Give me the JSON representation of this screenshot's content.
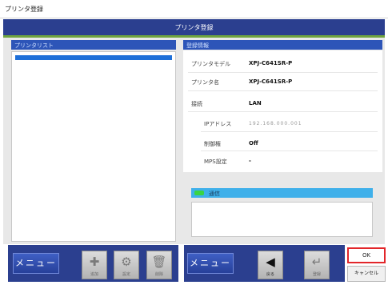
{
  "window": {
    "title": "プリンタ登録"
  },
  "header": {
    "title": "プリンタ登録"
  },
  "left_panel": {
    "title": "プリンタリスト"
  },
  "right_panel": {
    "title": "登録情報",
    "rows": {
      "model": {
        "label": "プリンタモデル",
        "value": "XPJ-C641SR-P"
      },
      "name": {
        "label": "プリンタ名",
        "value": "XPJ-C641SR-P"
      },
      "connection": {
        "label": "接続",
        "value": "LAN"
      },
      "ip": {
        "label": "IPアドレス",
        "value": "192.168.000.001"
      },
      "restrict": {
        "label": "制御権",
        "value": "Off"
      },
      "mps": {
        "label": "MPS設定",
        "value": "-"
      }
    }
  },
  "status": {
    "text": "通信"
  },
  "toolbar_left": {
    "menu_label": "メニュー",
    "add": {
      "icon": "plus-icon",
      "glyph": "✚",
      "label": "追加"
    },
    "settings": {
      "icon": "gear-icon",
      "glyph": "⚙",
      "label": "設定"
    },
    "delete": {
      "icon": "trash-icon",
      "glyph": "🗑",
      "label": "削除"
    }
  },
  "toolbar_right": {
    "menu_label": "メニュー",
    "back": {
      "icon": "arrow-left-icon",
      "glyph": "◀",
      "label": "戻る"
    },
    "enter": {
      "icon": "return-icon",
      "glyph": "↵",
      "label": "登録"
    }
  },
  "dialog": {
    "ok_label": "OK",
    "cancel_label": "キャンセル"
  },
  "colors": {
    "header": "#2b3f8f",
    "accent_green": "#6fa33e",
    "status_blue": "#3fb0ea",
    "ok_border": "#e2262a"
  }
}
